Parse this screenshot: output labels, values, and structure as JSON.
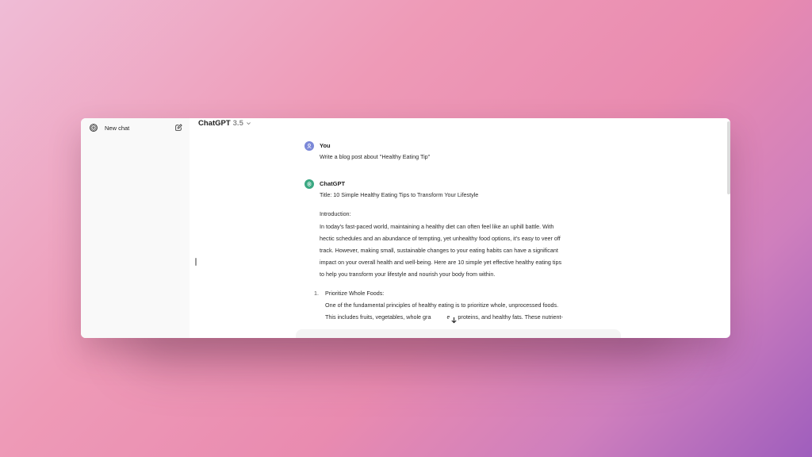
{
  "sidebar": {
    "new_chat_label": "New chat"
  },
  "header": {
    "model_name": "ChatGPT",
    "model_version": "3.5"
  },
  "conversation": {
    "user": {
      "author": "You",
      "message": "Write a blog post about \"Healthy Eating Tip\""
    },
    "assistant": {
      "author": "ChatGPT",
      "title": "Title: 10 Simple Healthy Eating Tips to Transform Your Lifestyle",
      "intro_heading": "Introduction:",
      "intro_lines": [
        "In today's fast-paced world, maintaining a healthy diet can often feel like an uphill battle. With",
        "hectic schedules and an abundance of tempting, yet unhealthy food options, it's easy to veer off",
        "track. However, making small, sustainable changes to your eating habits can have a significant",
        "impact on your overall health and well-being. Here are 10 simple yet effective healthy eating tips",
        "to help you transform your lifestyle and nourish your body from within."
      ],
      "list": [
        {
          "number": "1.",
          "heading": "Prioritize Whole Foods:",
          "lines": [
            "One of the fundamental principles of healthy eating is to prioritize whole, unprocessed foods.",
            "This includes fruits, vegetables, whole gra",
            "ean proteins, and healthy fats. These nutrient-"
          ]
        }
      ]
    }
  },
  "icons": {
    "logo": "openai-logo-icon",
    "edit": "edit-icon",
    "chevron": "chevron-down-icon",
    "user_avatar": "user-avatar-icon",
    "bot_avatar": "openai-logo-icon",
    "scroll_down": "arrow-down-icon"
  },
  "colors": {
    "user_avatar": "#7b88d8",
    "bot_avatar": "#3aa882"
  }
}
